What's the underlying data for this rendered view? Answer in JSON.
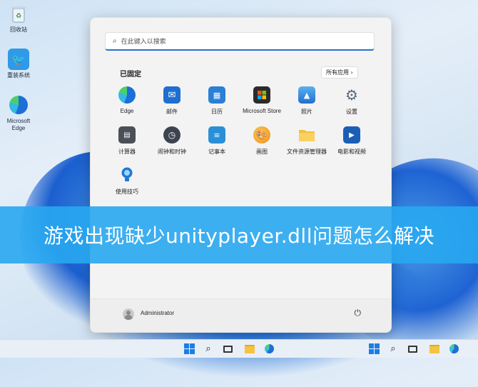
{
  "desktop": {
    "icons": [
      {
        "label": "回收站",
        "icon": "recycle-bin-icon"
      },
      {
        "label": "重装系统",
        "icon": "bird-app-icon"
      },
      {
        "label": "Microsoft Edge",
        "icon": "edge-icon"
      }
    ]
  },
  "start_menu": {
    "search_placeholder": "在此键入以搜索",
    "pinned_title": "已固定",
    "all_apps_label": "所有应用  ›",
    "apps": [
      {
        "label": "Edge",
        "icon": "edge-icon",
        "color": "#1d7bd8"
      },
      {
        "label": "邮件",
        "icon": "mail-icon",
        "color": "#1f6fd0"
      },
      {
        "label": "日历",
        "icon": "calendar-icon",
        "color": "#2a7fd6"
      },
      {
        "label": "Microsoft Store",
        "icon": "store-icon",
        "color": "#2b2b2b"
      },
      {
        "label": "照片",
        "icon": "photos-icon",
        "color": "#2a83d8"
      },
      {
        "label": "设置",
        "icon": "gear-icon",
        "color": "#5a6a7a"
      },
      {
        "label": "计算器",
        "icon": "calculator-icon",
        "color": "#4a4f58"
      },
      {
        "label": "闹钟和时钟",
        "icon": "clock-icon",
        "color": "#3d4450"
      },
      {
        "label": "记事本",
        "icon": "notepad-icon",
        "color": "#2b8fd8"
      },
      {
        "label": "画图",
        "icon": "paint-icon",
        "color": "#f0a030"
      },
      {
        "label": "文件资源管理器",
        "icon": "folder-icon",
        "color": "#f4c03c"
      },
      {
        "label": "电影和视频",
        "icon": "video-icon",
        "color": "#1b5fb5"
      },
      {
        "label": "使用技巧",
        "icon": "tips-icon",
        "color": "#1f78d6"
      }
    ],
    "username": "Administrator"
  },
  "banner": {
    "text": "游戏出现缺少unityplayer.dll问题怎么解决"
  },
  "taskbar": {
    "items": [
      "windows-start-icon",
      "search-icon",
      "task-view-icon",
      "file-explorer-icon",
      "edge-icon"
    ]
  }
}
